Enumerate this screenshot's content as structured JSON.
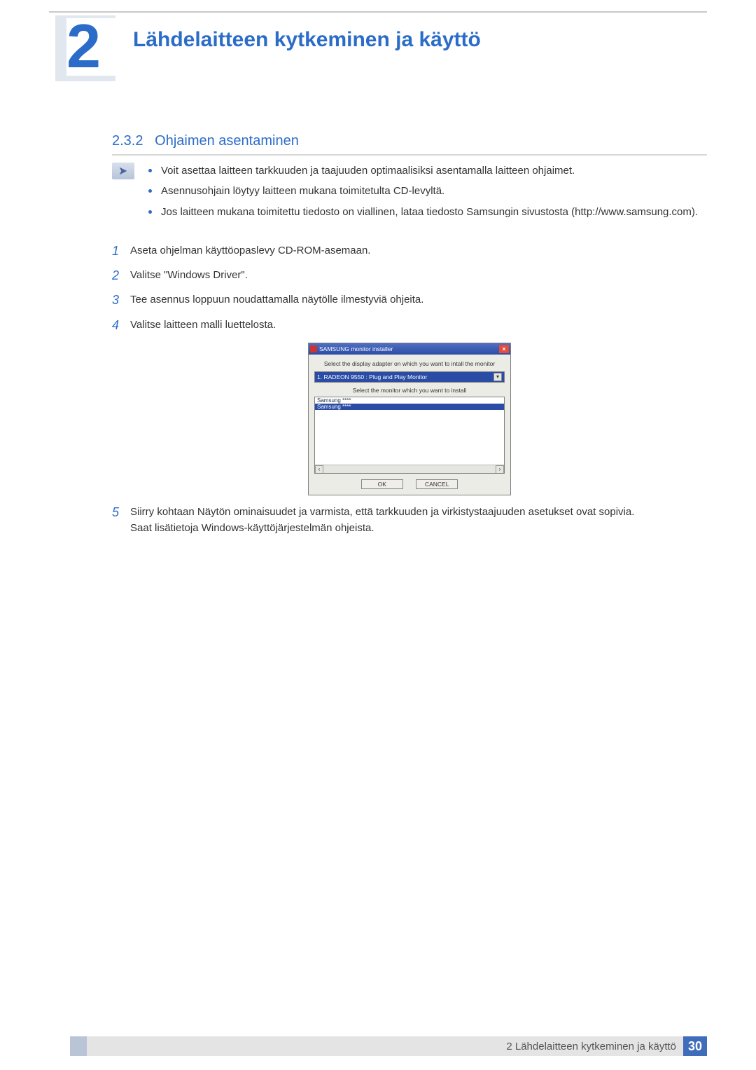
{
  "chapter_number": "2",
  "chapter_title": "Lähdelaitteen kytkeminen ja käyttö",
  "section": {
    "number": "2.3.2",
    "title": "Ohjaimen asentaminen"
  },
  "note_bullets": [
    "Voit asettaa laitteen tarkkuuden ja taajuuden optimaalisiksi asentamalla laitteen ohjaimet.",
    "Asennusohjain löytyy laitteen mukana toimitetulta CD-levyltä.",
    "Jos laitteen mukana toimitettu tiedosto on viallinen, lataa tiedosto Samsungin sivustosta (http://www.samsung.com)."
  ],
  "steps": [
    {
      "n": "1",
      "text": "Aseta ohjelman käyttöopaslevy CD-ROM-asemaan."
    },
    {
      "n": "2",
      "text": "Valitse \"Windows Driver\"."
    },
    {
      "n": "3",
      "text": "Tee asennus loppuun noudattamalla näytölle ilmestyviä ohjeita."
    },
    {
      "n": "4",
      "text": "Valitse laitteen malli luettelosta."
    },
    {
      "n": "5",
      "text": "Siirry kohtaan Näytön ominaisuudet ja varmista, että tarkkuuden ja virkistystaajuuden asetukset ovat sopivia."
    }
  ],
  "step5_extra": "Saat lisätietoja Windows-käyttöjärjestelmän ohjeista.",
  "installer": {
    "titlebar": "SAMSUNG monitor installer",
    "label_adapter": "Select the display adapter on which you want to intall the monitor",
    "adapter_value": "1. RADEON 9550 : Plug and Play Monitor",
    "label_monitor": "Select the monitor which you want to install",
    "list_items": [
      "Samsung ****",
      "Samsung ****"
    ],
    "selected_index": 1,
    "ok": "OK",
    "cancel": "CANCEL"
  },
  "footer": {
    "text": "2 Lähdelaitteen kytkeminen ja käyttö",
    "page": "30"
  }
}
